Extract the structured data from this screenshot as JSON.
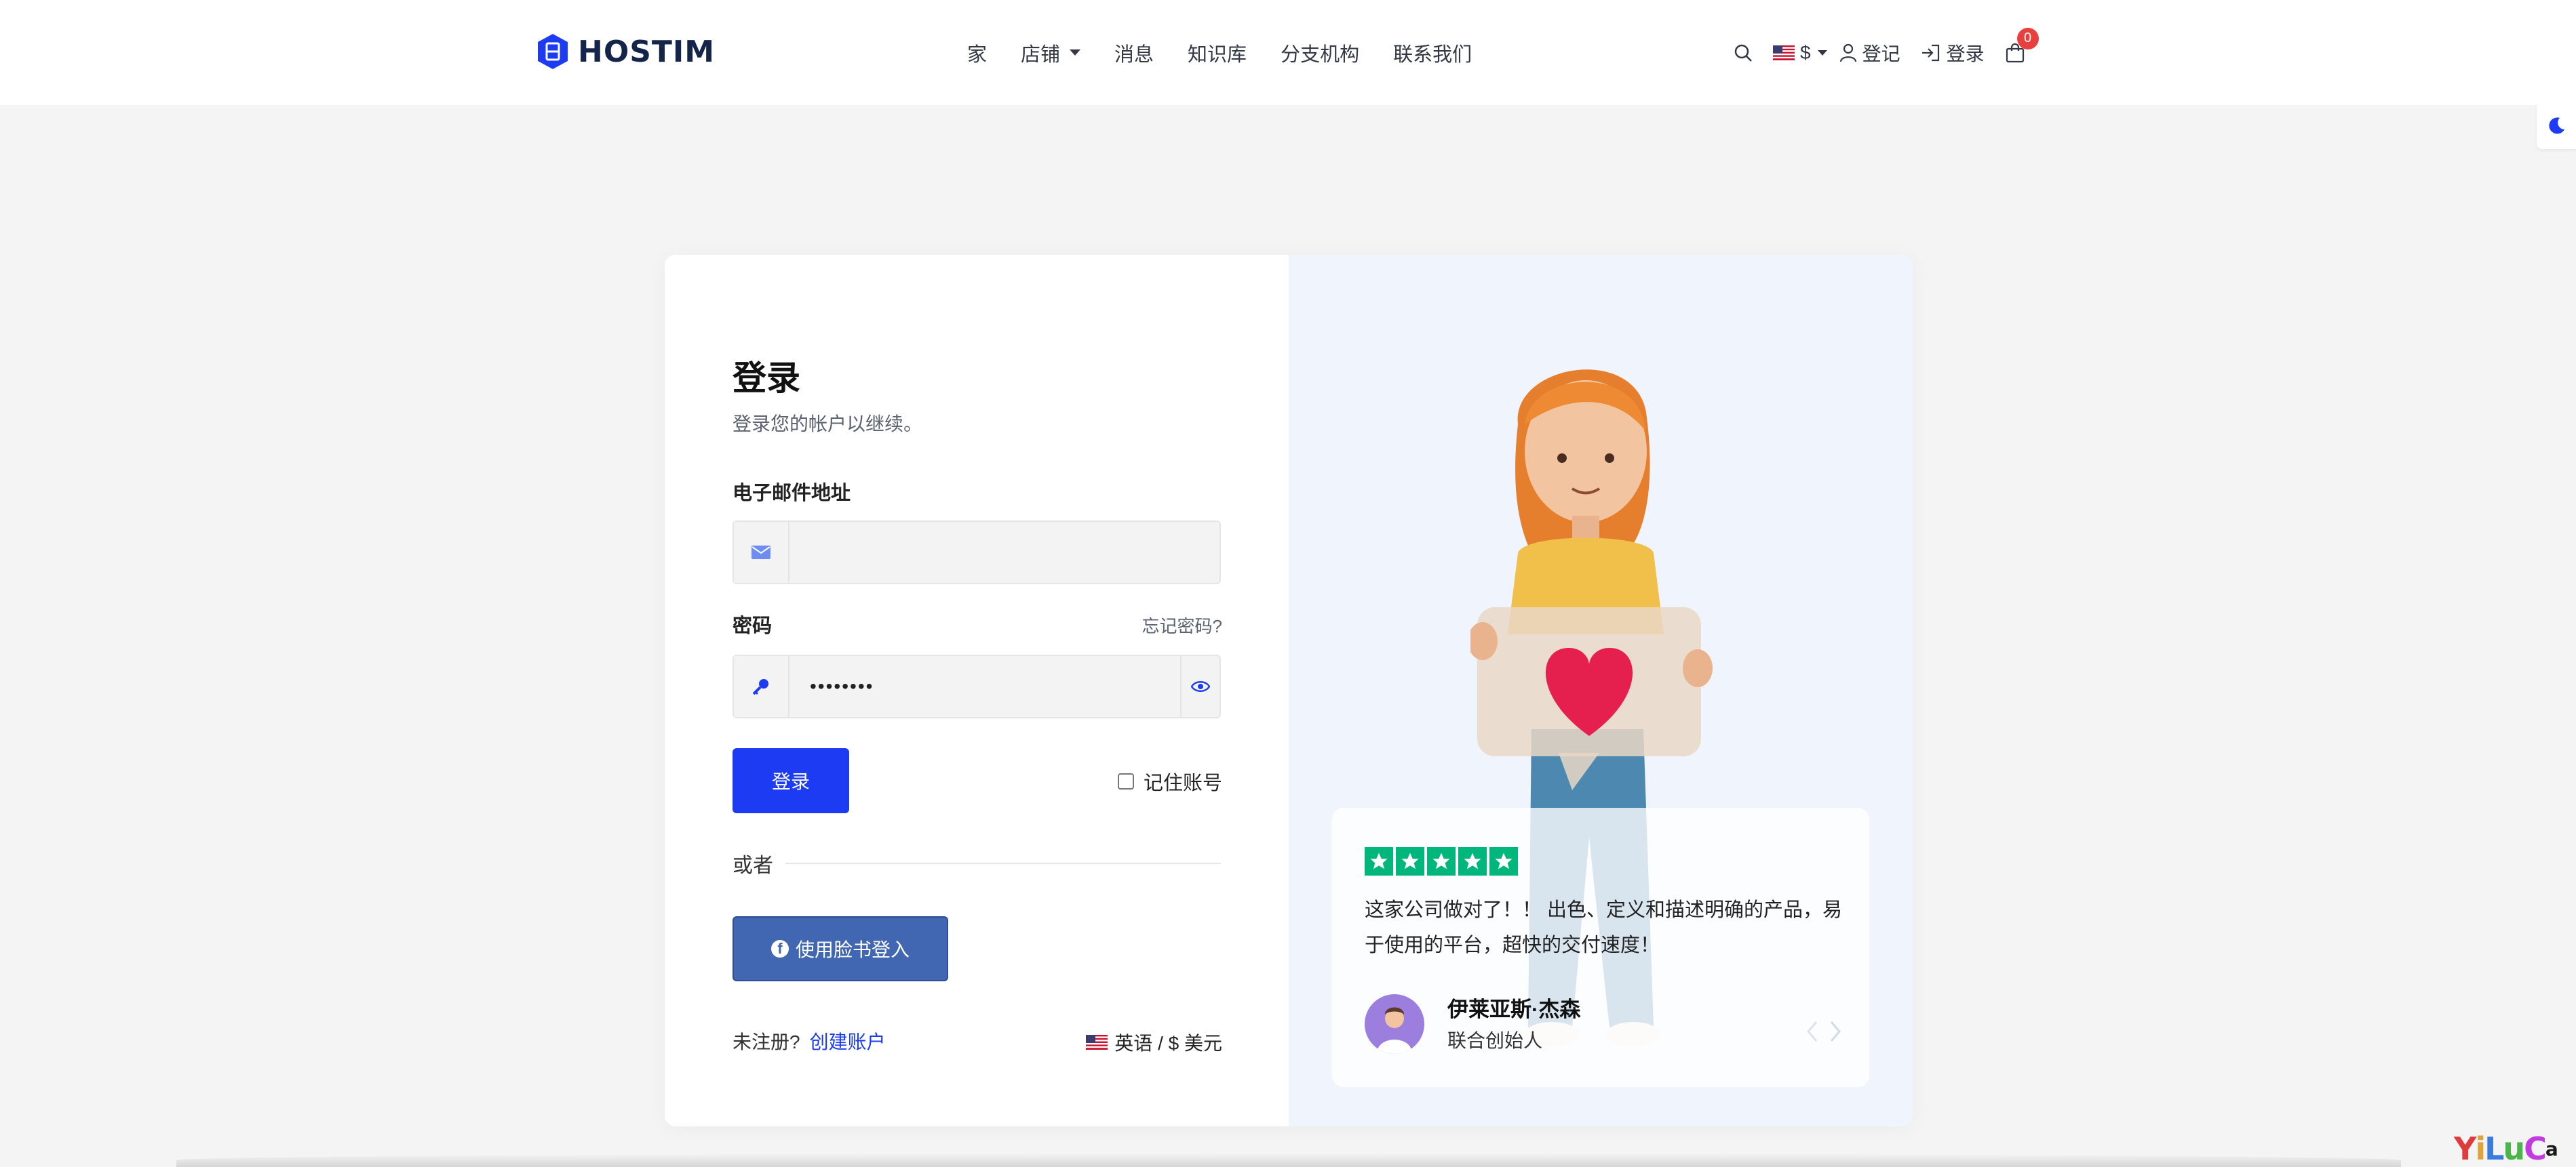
{
  "brand": {
    "name": "HOSTIM"
  },
  "nav": {
    "items": [
      {
        "label": "家"
      },
      {
        "label": "店铺",
        "dropdown": true
      },
      {
        "label": "消息"
      },
      {
        "label": "知识库"
      },
      {
        "label": "分支机构"
      },
      {
        "label": "联系我们"
      }
    ]
  },
  "tools": {
    "currency": "$",
    "register": "登记",
    "login": "登录",
    "cart_count": "0"
  },
  "login": {
    "title": "登录",
    "subtitle": "登录您的帐户以继续。",
    "email_label": "电子邮件地址",
    "email_value": "",
    "password_label": "密码",
    "forgot": "忘记密码?",
    "password_value": "••••••••",
    "submit": "登录",
    "remember": "记住账号",
    "or": "或者",
    "facebook": "使用脸书登入",
    "no_account": "未注册?",
    "create_account": "创建账户",
    "language": "英语 / $ 美元"
  },
  "review": {
    "rating": 5,
    "quote": "这家公司做对了！！ 出色、定义和描述明确的产品，易于使用的平台，超快的交付速度！",
    "name": "伊莱亚斯·杰森",
    "role": "联合创始人"
  },
  "colors": {
    "primary": "#1c3bf2",
    "facebook": "#4267b2",
    "trustpilot": "#00b67a",
    "badge": "#e8413d"
  },
  "watermark": {
    "text": "YiLuCa"
  }
}
